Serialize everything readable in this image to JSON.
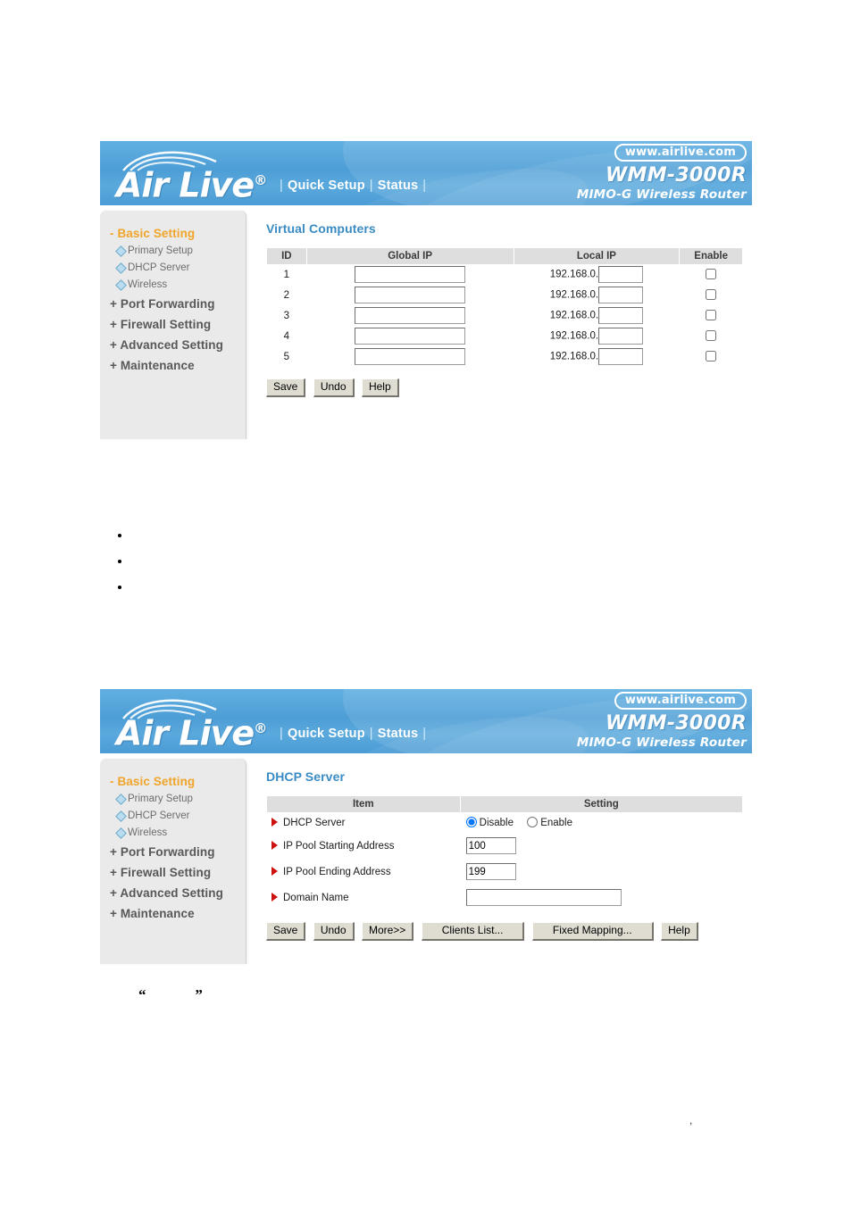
{
  "banner": {
    "logo_text": "Air Live",
    "logo_registered": "®",
    "nav": [
      {
        "label": "Quick Setup"
      },
      {
        "label": "Status"
      }
    ],
    "url_badge": "www.airlive.com",
    "model": "WMM-3000R",
    "model_subtitle": "MIMO-G Wireless Router",
    "accent_blue": "#4d9ed6"
  },
  "sidebar": {
    "head": {
      "label": "- Basic Setting",
      "color": "#f0a52b"
    },
    "sub_items": [
      {
        "label": "Primary Setup"
      },
      {
        "label": "DHCP Server"
      },
      {
        "label": "Wireless"
      }
    ],
    "top_items": [
      {
        "label": "+ Port Forwarding"
      },
      {
        "label": "+ Firewall Setting"
      },
      {
        "label": "+ Advanced Setting"
      },
      {
        "label": "+ Maintenance"
      }
    ]
  },
  "virtual_computers": {
    "title": "Virtual Computers",
    "columns": [
      "ID",
      "Global IP",
      "Local IP",
      "Enable"
    ],
    "local_ip_prefix": "192.168.0.",
    "rows": [
      {
        "id": "1",
        "global_ip": "",
        "local_ip_suffix": "",
        "enabled": false
      },
      {
        "id": "2",
        "global_ip": "",
        "local_ip_suffix": "",
        "enabled": false
      },
      {
        "id": "3",
        "global_ip": "",
        "local_ip_suffix": "",
        "enabled": false
      },
      {
        "id": "4",
        "global_ip": "",
        "local_ip_suffix": "",
        "enabled": false
      },
      {
        "id": "5",
        "global_ip": "",
        "local_ip_suffix": "",
        "enabled": false
      }
    ],
    "buttons": [
      {
        "label": "Save"
      },
      {
        "label": "Undo"
      },
      {
        "label": "Help"
      }
    ]
  },
  "dhcp_server": {
    "title": "DHCP Server",
    "columns": [
      "Item",
      "Setting"
    ],
    "rows": [
      {
        "item": "DHCP Server",
        "type": "radio",
        "options": [
          {
            "label": "Disable",
            "selected": true
          },
          {
            "label": "Enable",
            "selected": false
          }
        ]
      },
      {
        "item": "IP Pool Starting Address",
        "type": "text",
        "value": "100"
      },
      {
        "item": "IP Pool Ending Address",
        "type": "text",
        "value": "199"
      },
      {
        "item": "Domain Name",
        "type": "text",
        "value": ""
      }
    ],
    "buttons": [
      {
        "label": "Save"
      },
      {
        "label": "Undo"
      },
      {
        "label": "More>>"
      },
      {
        "label": "Clients List..."
      },
      {
        "label": "Fixed Mapping..."
      },
      {
        "label": "Help"
      }
    ]
  },
  "document_marks": {
    "bullets": [
      "",
      "",
      ""
    ],
    "quote_open": "“",
    "quote_close": "”",
    "stray_comma": ","
  }
}
